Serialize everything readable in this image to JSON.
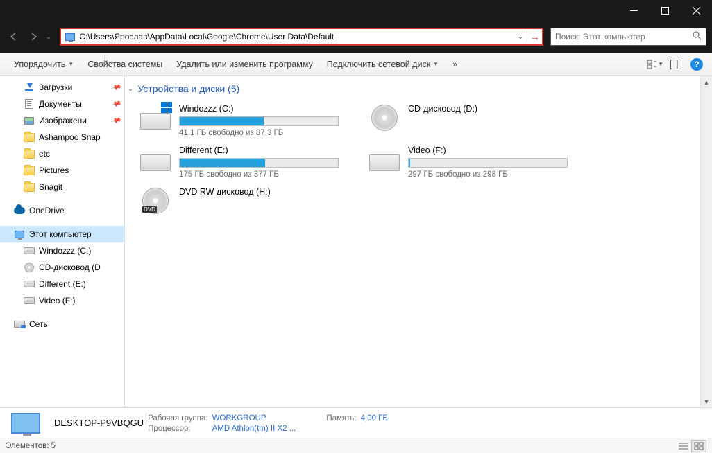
{
  "titlebar": {},
  "nav": {
    "address": "C:\\Users\\Ярослав\\AppData\\Local\\Google\\Chrome\\User Data\\Default",
    "search_placeholder": "Поиск: Этот компьютер"
  },
  "toolbar": {
    "organize": "Упорядочить",
    "properties": "Свойства системы",
    "uninstall": "Удалить или изменить программу",
    "map_drive": "Подключить сетевой диск",
    "overflow": "»"
  },
  "sidebar": {
    "downloads": "Загрузки",
    "documents": "Документы",
    "pictures_ru": "Изображени",
    "ashampoo": "Ashampoo Snap",
    "etc": "etc",
    "pictures": "Pictures",
    "snagit": "Snagit",
    "onedrive": "OneDrive",
    "this_pc": "Этот компьютер",
    "drive_c": "Windozzz (C:)",
    "drive_d": "CD-дисковод (D",
    "drive_e": "Different (E:)",
    "drive_f": "Video (F:)",
    "network": "Сеть"
  },
  "content": {
    "group_header": "Устройства и диски (5)",
    "drives": [
      {
        "name": "Windozzz (C:)",
        "info": "41,1 ГБ свободно из 87,3 ГБ",
        "fill": 53,
        "type": "os"
      },
      {
        "name": "CD-дисковод (D:)",
        "info": "",
        "fill": null,
        "type": "cd"
      },
      {
        "name": "Different (E:)",
        "info": "175 ГБ свободно из 377 ГБ",
        "fill": 54,
        "type": "hdd"
      },
      {
        "name": "Video (F:)",
        "info": "297 ГБ свободно из 298 ГБ",
        "fill": 1,
        "type": "hdd"
      },
      {
        "name": "DVD RW дисковод (H:)",
        "info": "",
        "fill": null,
        "type": "dvd"
      }
    ]
  },
  "details": {
    "name": "DESKTOP-P9VBQGU",
    "workgroup_label": "Рабочая группа:",
    "workgroup": "WORKGROUP",
    "cpu_label": "Процессор:",
    "cpu": "AMD Athlon(tm) II X2 ...",
    "memory_label": "Память:",
    "memory": "4,00 ГБ"
  },
  "status": {
    "items_label": "Элементов: 5"
  }
}
